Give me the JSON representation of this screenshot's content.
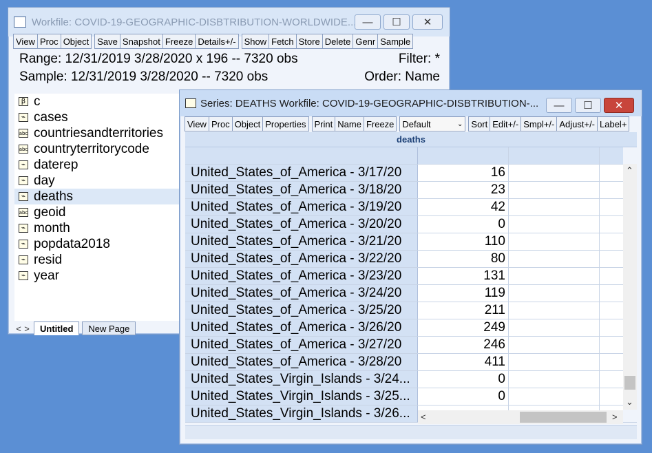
{
  "workfile": {
    "title": "Workfile: COVID-19-GEOGRAPHIC-DISBTRIBUTION-WORLDWIDE...",
    "buttons": [
      "View",
      "Proc",
      "Object",
      "Save",
      "Snapshot",
      "Freeze",
      "Details+/-",
      "Show",
      "Fetch",
      "Store",
      "Delete",
      "Genr",
      "Sample"
    ],
    "range_label": "Range:  12/31/2019 3/28/2020 x 196   --    7320 obs",
    "filter": "Filter: *",
    "sample_label": "Sample: 12/31/2019 3/28/2020   --    7320 obs",
    "order": "Order: Name",
    "objects": [
      {
        "name": "c",
        "icon": "β"
      },
      {
        "name": "cases",
        "icon": "series"
      },
      {
        "name": "countriesandterritories",
        "icon": "abc"
      },
      {
        "name": "countryterritorycode",
        "icon": "abc"
      },
      {
        "name": "daterep",
        "icon": "series"
      },
      {
        "name": "day",
        "icon": "series"
      },
      {
        "name": "deaths",
        "icon": "series"
      },
      {
        "name": "geoid",
        "icon": "abc"
      },
      {
        "name": "month",
        "icon": "series"
      },
      {
        "name": "popdata2018",
        "icon": "series"
      },
      {
        "name": "resid",
        "icon": "series"
      },
      {
        "name": "year",
        "icon": "series"
      }
    ],
    "tabs": [
      "Untitled",
      "New Page"
    ]
  },
  "series": {
    "title": "Series: DEATHS   Workfile: COVID-19-GEOGRAPHIC-DISBTRIBUTION-...",
    "buttons": [
      "View",
      "Proc",
      "Object",
      "Properties",
      "Print",
      "Name",
      "Freeze"
    ],
    "dropdown": "Default",
    "buttons2": [
      "Sort",
      "Edit+/-",
      "Smpl+/-",
      "Adjust+/-",
      "Label+"
    ],
    "column_header": "deaths",
    "rows": [
      {
        "label": "United_States_of_America - 3/17/20",
        "value": "16"
      },
      {
        "label": "United_States_of_America - 3/18/20",
        "value": "23"
      },
      {
        "label": "United_States_of_America - 3/19/20",
        "value": "42"
      },
      {
        "label": "United_States_of_America - 3/20/20",
        "value": "0"
      },
      {
        "label": "United_States_of_America - 3/21/20",
        "value": "110"
      },
      {
        "label": "United_States_of_America - 3/22/20",
        "value": "80"
      },
      {
        "label": "United_States_of_America - 3/23/20",
        "value": "131"
      },
      {
        "label": "United_States_of_America - 3/24/20",
        "value": "119"
      },
      {
        "label": "United_States_of_America - 3/25/20",
        "value": "211"
      },
      {
        "label": "United_States_of_America - 3/26/20",
        "value": "249"
      },
      {
        "label": "United_States_of_America - 3/27/20",
        "value": "246"
      },
      {
        "label": "United_States_of_America - 3/28/20",
        "value": "411"
      },
      {
        "label": "United_States_Virgin_Islands - 3/24...",
        "value": "0"
      },
      {
        "label": "United_States_Virgin_Islands - 3/25...",
        "value": "0"
      },
      {
        "label": "United_States_Virgin_Islands - 3/26...",
        "value": ""
      }
    ]
  }
}
